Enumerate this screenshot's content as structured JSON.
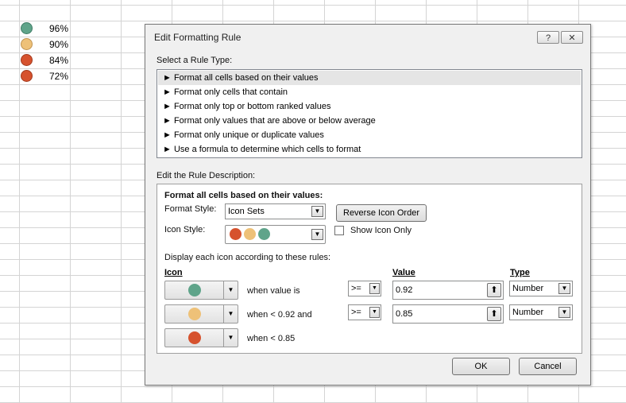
{
  "colors": {
    "green": "#5fa48a",
    "yellow": "#eec178",
    "red": "#d6522e"
  },
  "sheet": {
    "rows": [
      {
        "value": "96%",
        "icon": "green-circle-icon",
        "color": "#5fa48a"
      },
      {
        "value": "90%",
        "icon": "yellow-circle-icon",
        "color": "#eec178"
      },
      {
        "value": "84%",
        "icon": "red-circle-icon",
        "color": "#d6522e"
      },
      {
        "value": "72%",
        "icon": "red-circle-icon",
        "color": "#d6522e"
      }
    ]
  },
  "dialog": {
    "title": "Edit Formatting Rule",
    "help_label": "?",
    "close_label": "✕",
    "select_rule_type_label": "Select a Rule Type:",
    "rule_types": [
      "Format all cells based on their values",
      "Format only cells that contain",
      "Format only top or bottom ranked values",
      "Format only values that are above or below average",
      "Format only unique or duplicate values",
      "Use a formula to determine which cells to format"
    ],
    "selected_rule_index": 0,
    "edit_desc_label": "Edit the Rule Description:",
    "desc_heading": "Format all cells based on their values:",
    "format_style_label": "Format Style:",
    "format_style_value": "Icon Sets",
    "reverse_icon_order_label": "Reverse Icon Order",
    "icon_style_label": "Icon Style:",
    "show_icon_only_label": "Show Icon Only",
    "show_icon_only_checked": false,
    "display_rules_label": "Display each icon according to these rules:",
    "col_icon": "Icon",
    "col_value": "Value",
    "col_type": "Type",
    "rules": [
      {
        "icon": "green-circle-icon",
        "color": "#5fa48a",
        "condition": "when value is",
        "operator": ">=",
        "value": "0.92",
        "type": "Number"
      },
      {
        "icon": "yellow-circle-icon",
        "color": "#eec178",
        "condition": "when < 0.92 and",
        "operator": ">=",
        "value": "0.85",
        "type": "Number"
      },
      {
        "icon": "red-circle-icon",
        "color": "#d6522e",
        "condition": "when < 0.85"
      }
    ],
    "ok_label": "OK",
    "cancel_label": "Cancel"
  }
}
